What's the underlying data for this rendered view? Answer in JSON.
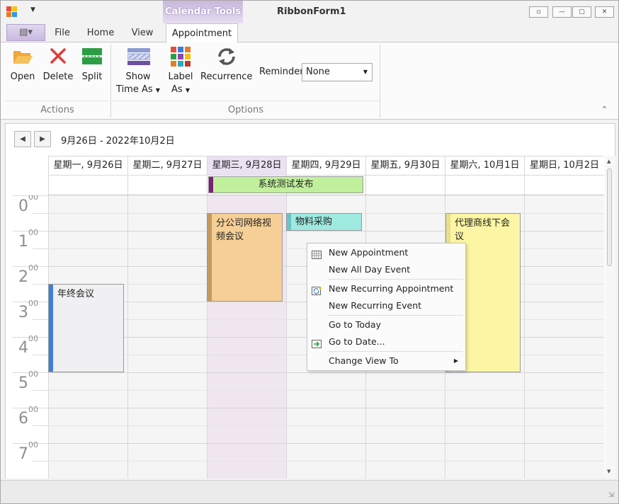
{
  "window": {
    "title": "RibbonForm1",
    "context_tab_header": "Calendar Tools",
    "controls": [
      "minimize",
      "restore",
      "close"
    ]
  },
  "tabs": {
    "file": "File",
    "home": "Home",
    "view": "View",
    "appointment": "Appointment"
  },
  "ribbon": {
    "actions": {
      "group_label": "Actions",
      "open": "Open",
      "delete": "Delete",
      "split": "Split"
    },
    "options": {
      "group_label": "Options",
      "show_time_as_1": "Show",
      "show_time_as_2": "Time As",
      "label_as_1": "Label",
      "label_as_2": "As",
      "recurrence": "Recurrence",
      "reminder_label": "Reminder",
      "reminder_value": "None"
    }
  },
  "scheduler": {
    "date_range": "9月26日 - 2022年10月2日",
    "days": [
      {
        "label": "星期一, 9月26日"
      },
      {
        "label": "星期二, 9月27日"
      },
      {
        "label": "星期三, 9月28日"
      },
      {
        "label": "星期四, 9月29日"
      },
      {
        "label": "星期五, 9月30日"
      },
      {
        "label": "星期六, 10月1日"
      },
      {
        "label": "星期日, 10月2日"
      }
    ],
    "selected_day_index": 2,
    "hours": [
      {
        "h": "0",
        "m": "00"
      },
      {
        "h": "1",
        "m": "00"
      },
      {
        "h": "2",
        "m": "00"
      },
      {
        "h": "3",
        "m": "00"
      },
      {
        "h": "4",
        "m": "00"
      },
      {
        "h": "5",
        "m": "00"
      },
      {
        "h": "6",
        "m": "00"
      },
      {
        "h": "7",
        "m": "00"
      }
    ],
    "all_day_appointments": [
      {
        "subject": "系统测试发布",
        "color": "#c1f09c",
        "status_color": "#7a1f7a"
      }
    ],
    "appointments": [
      {
        "subject": "分公司网络视频会议",
        "color": "#f6cf96",
        "status_color": "#c49a5e"
      },
      {
        "subject": "物料采购",
        "color": "#9ee9e0",
        "status_color": "#6cc3c1"
      },
      {
        "subject": "代理商线下会议",
        "color": "#fcf6a4",
        "status_color": "#e9de8e"
      },
      {
        "subject": "年终会议",
        "color": "#f0f0f2",
        "status_color": "#3f7fd9"
      }
    ]
  },
  "context_menu": {
    "items": [
      {
        "label": "New Appointment",
        "icon": "calendar-grid-icon"
      },
      {
        "label": "New All Day Event",
        "icon": ""
      },
      {
        "label": "New Recurring Appointment",
        "icon": "recurring-icon"
      },
      {
        "label": "New Recurring Event",
        "icon": ""
      },
      {
        "label": "Go to Today",
        "icon": ""
      },
      {
        "label": "Go to Date...",
        "icon": "goto-date-icon"
      },
      {
        "label": "Change View To",
        "icon": "",
        "submenu": true
      }
    ]
  },
  "colors": {
    "accent_purple": "#c9b9df",
    "selected_day": "#ebe1f2"
  }
}
